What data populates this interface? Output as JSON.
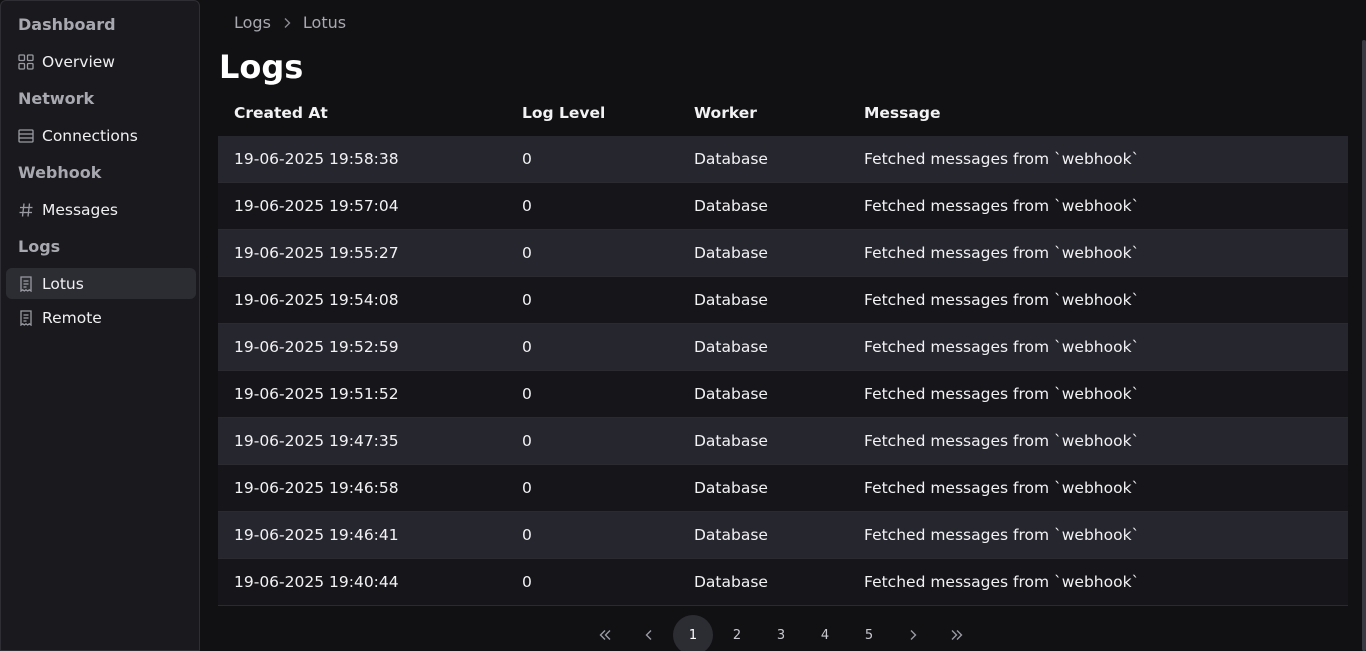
{
  "sidebar": {
    "sections": [
      {
        "heading": "Dashboard",
        "items": [
          {
            "label": "Overview",
            "icon": "grid-icon"
          }
        ]
      },
      {
        "heading": "Network",
        "items": [
          {
            "label": "Connections",
            "icon": "server-icon"
          }
        ]
      },
      {
        "heading": "Webhook",
        "items": [
          {
            "label": "Messages",
            "icon": "hash-icon"
          }
        ]
      },
      {
        "heading": "Logs",
        "items": [
          {
            "label": "Lotus",
            "icon": "receipt-icon",
            "active": true
          },
          {
            "label": "Remote",
            "icon": "receipt-icon"
          }
        ]
      }
    ]
  },
  "breadcrumb": {
    "root": "Logs",
    "current": "Lotus"
  },
  "page": {
    "title": "Logs"
  },
  "table": {
    "columns": [
      "Created At",
      "Log Level",
      "Worker",
      "Message"
    ],
    "rows": [
      [
        "19-06-2025 19:58:38",
        "0",
        "Database",
        "Fetched messages from `webhook`"
      ],
      [
        "19-06-2025 19:57:04",
        "0",
        "Database",
        "Fetched messages from `webhook`"
      ],
      [
        "19-06-2025 19:55:27",
        "0",
        "Database",
        "Fetched messages from `webhook`"
      ],
      [
        "19-06-2025 19:54:08",
        "0",
        "Database",
        "Fetched messages from `webhook`"
      ],
      [
        "19-06-2025 19:52:59",
        "0",
        "Database",
        "Fetched messages from `webhook`"
      ],
      [
        "19-06-2025 19:51:52",
        "0",
        "Database",
        "Fetched messages from `webhook`"
      ],
      [
        "19-06-2025 19:47:35",
        "0",
        "Database",
        "Fetched messages from `webhook`"
      ],
      [
        "19-06-2025 19:46:58",
        "0",
        "Database",
        "Fetched messages from `webhook`"
      ],
      [
        "19-06-2025 19:46:41",
        "0",
        "Database",
        "Fetched messages from `webhook`"
      ],
      [
        "19-06-2025 19:40:44",
        "0",
        "Database",
        "Fetched messages from `webhook`"
      ]
    ]
  },
  "pagination": {
    "pages": [
      "1",
      "2",
      "3",
      "4",
      "5"
    ],
    "current": "1"
  },
  "colors": {
    "background": "#111114",
    "sidebar": "#1a1a1e",
    "row_alt": "#26262e",
    "active_item": "#2c2c33"
  }
}
